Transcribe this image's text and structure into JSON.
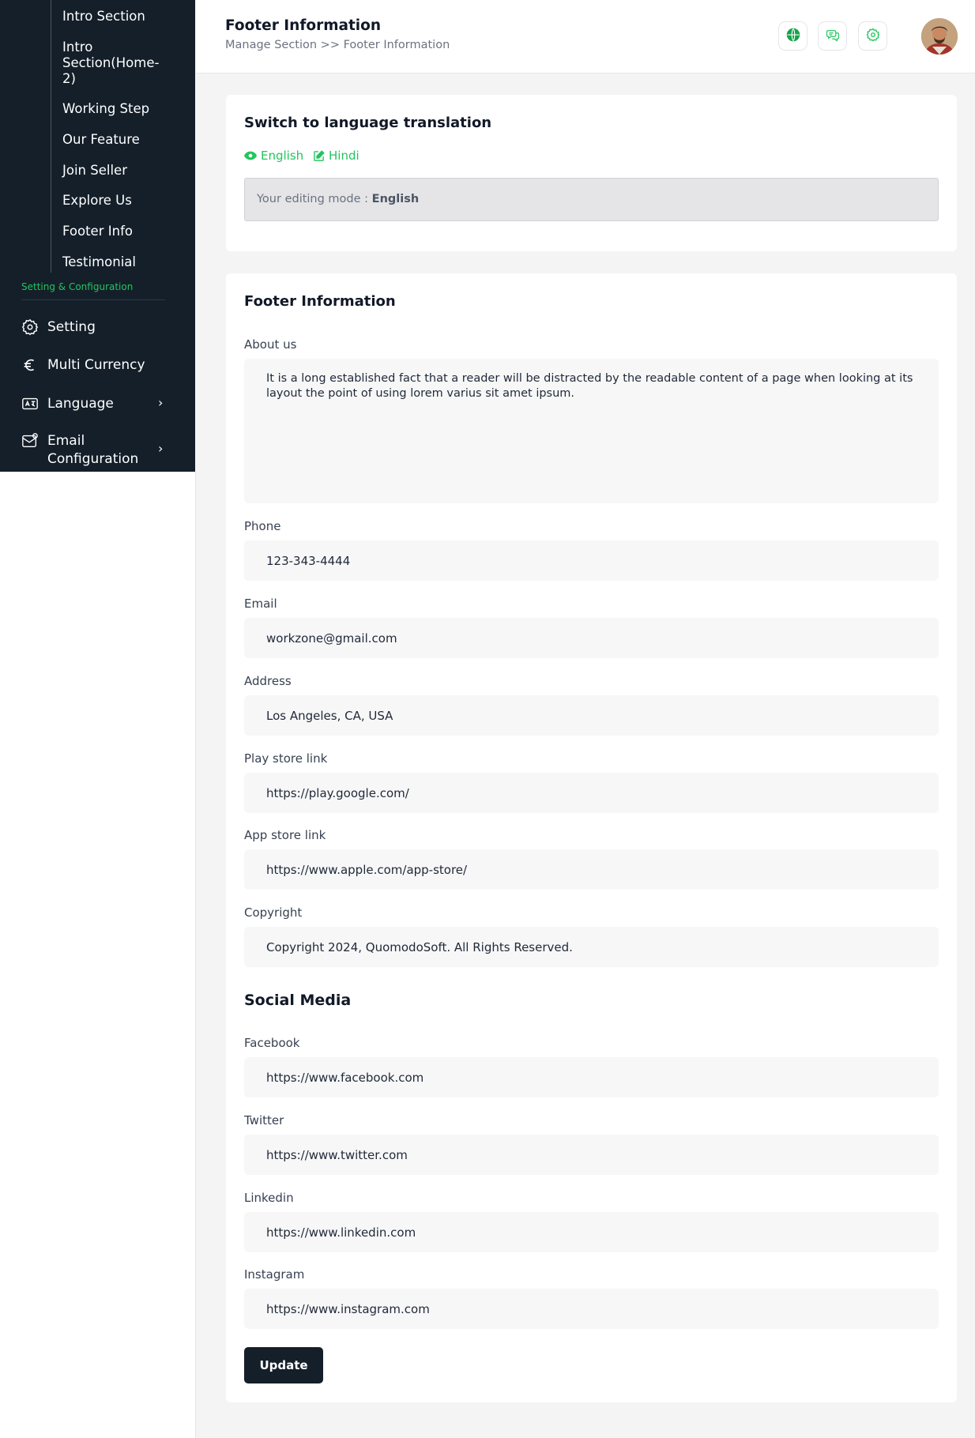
{
  "sidebar": {
    "sub_items": [
      {
        "label": "Intro Section"
      },
      {
        "label": "Intro Section(Home-2)"
      },
      {
        "label": "Working Step"
      },
      {
        "label": "Our Feature"
      },
      {
        "label": "Join Seller"
      },
      {
        "label": "Explore Us"
      },
      {
        "label": "Footer Info"
      },
      {
        "label": "Testimonial"
      }
    ],
    "section_label": "Setting & Configuration",
    "nav_items": [
      {
        "label": "Setting",
        "icon": "gear-icon"
      },
      {
        "label": "Multi Currency",
        "icon": "euro-icon"
      },
      {
        "label": "Language",
        "icon": "language-icon"
      },
      {
        "label": "Email Configuration",
        "icon": "email-icon"
      }
    ]
  },
  "header": {
    "title": "Footer Information",
    "breadcrumb": "Manage Section >> Footer Information",
    "icons": [
      "globe-icon",
      "chat-icon",
      "settings-icon"
    ]
  },
  "translation": {
    "title": "Switch to language translation",
    "languages": [
      "English",
      "Hindi"
    ],
    "mode_prefix": "Your editing mode :",
    "mode_value": "English"
  },
  "footer_info": {
    "title": "Footer Information",
    "about_label": "About us",
    "about_value": "It is a long established fact that a reader will be distracted by the readable content of a page when looking at its layout the point of using lorem varius sit amet ipsum.",
    "phone_label": "Phone",
    "phone_value": "123-343-4444",
    "email_label": "Email",
    "email_value": "workzone@gmail.com",
    "address_label": "Address",
    "address_value": "Los Angeles, CA, USA",
    "playstore_label": "Play store link",
    "playstore_value": "https://play.google.com/",
    "appstore_label": "App store link",
    "appstore_value": "https://www.apple.com/app-store/",
    "copyright_label": "Copyright",
    "copyright_value": "Copyright 2024, QuomodoSoft. All Rights Reserved."
  },
  "social": {
    "title": "Social Media",
    "facebook_label": "Facebook",
    "facebook_value": "https://www.facebook.com",
    "twitter_label": "Twitter",
    "twitter_value": "https://www.twitter.com",
    "linkedin_label": "Linkedin",
    "linkedin_value": "https://www.linkedin.com",
    "instagram_label": "Instagram",
    "instagram_value": "https://www.instagram.com"
  },
  "update_label": "Update",
  "colors": {
    "accent": "#22c55e",
    "sidebar": "#141f2a"
  }
}
